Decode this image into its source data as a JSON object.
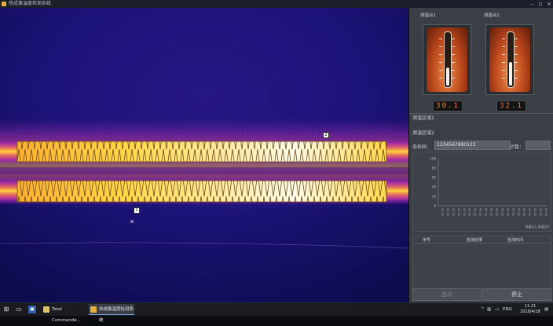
{
  "window": {
    "title": "热成像温度检测系统"
  },
  "sensors": [
    {
      "label": "测温点1",
      "value": "30.1",
      "level": 0.35
    },
    {
      "label": "测温点2",
      "value": "32.1",
      "level": 0.45
    }
  ],
  "markers": [
    {
      "label": "2"
    },
    {
      "label": "1"
    }
  ],
  "regions": [
    "测温区域1",
    "测温区域2"
  ],
  "barcode": {
    "label": "条形码：",
    "value": "1234567890123"
  },
  "count": {
    "label": "计数：",
    "value": ""
  },
  "chart_data": {
    "type": "line",
    "yticks": [
      "100",
      "80",
      "60",
      "40",
      "20",
      "0"
    ],
    "xticks": [
      "07:21",
      "07:21",
      "07:21",
      "07:21",
      "07:21",
      "07:21",
      "07:21",
      "07:21",
      "07:21",
      "07:21",
      "07:21",
      "07:21",
      "07:21",
      "07:21",
      "07:21",
      "07:21",
      "07:21",
      "07:21",
      "07:21",
      "07:21"
    ],
    "legend": [
      "测温点1",
      "测温点2"
    ],
    "series": []
  },
  "table": {
    "headers": [
      "序号",
      "检测结果",
      "检测时间"
    ]
  },
  "buttons": {
    "start": "启动",
    "stop": "停止"
  },
  "taskbar": {
    "apps": [
      {
        "label": "Total Commande...",
        "color": "#d8c36a"
      },
      {
        "label": "热成像温度检测系统",
        "color": "#e0b042"
      }
    ],
    "lang": "ENG",
    "time": "11:21",
    "date": "2018/4/18"
  }
}
